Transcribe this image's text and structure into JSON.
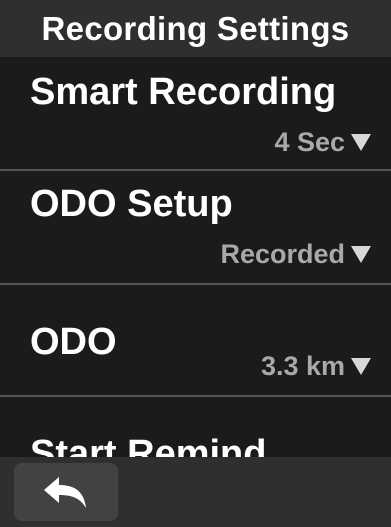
{
  "header": {
    "title": "Recording Settings"
  },
  "settings": {
    "items": [
      {
        "label": "Smart Recording",
        "value": "4 Sec"
      },
      {
        "label": "ODO Setup",
        "value": "Recorded"
      },
      {
        "label": "ODO",
        "value": "3.3 km"
      },
      {
        "label": "Start Remind",
        "value": ""
      }
    ]
  },
  "footer": {
    "back_icon": "back-arrow-icon"
  },
  "colors": {
    "header_bg": "#2f2f2f",
    "list_bg": "#1b1b1b",
    "value_text": "#a9a9a9",
    "divider": "#555555"
  }
}
